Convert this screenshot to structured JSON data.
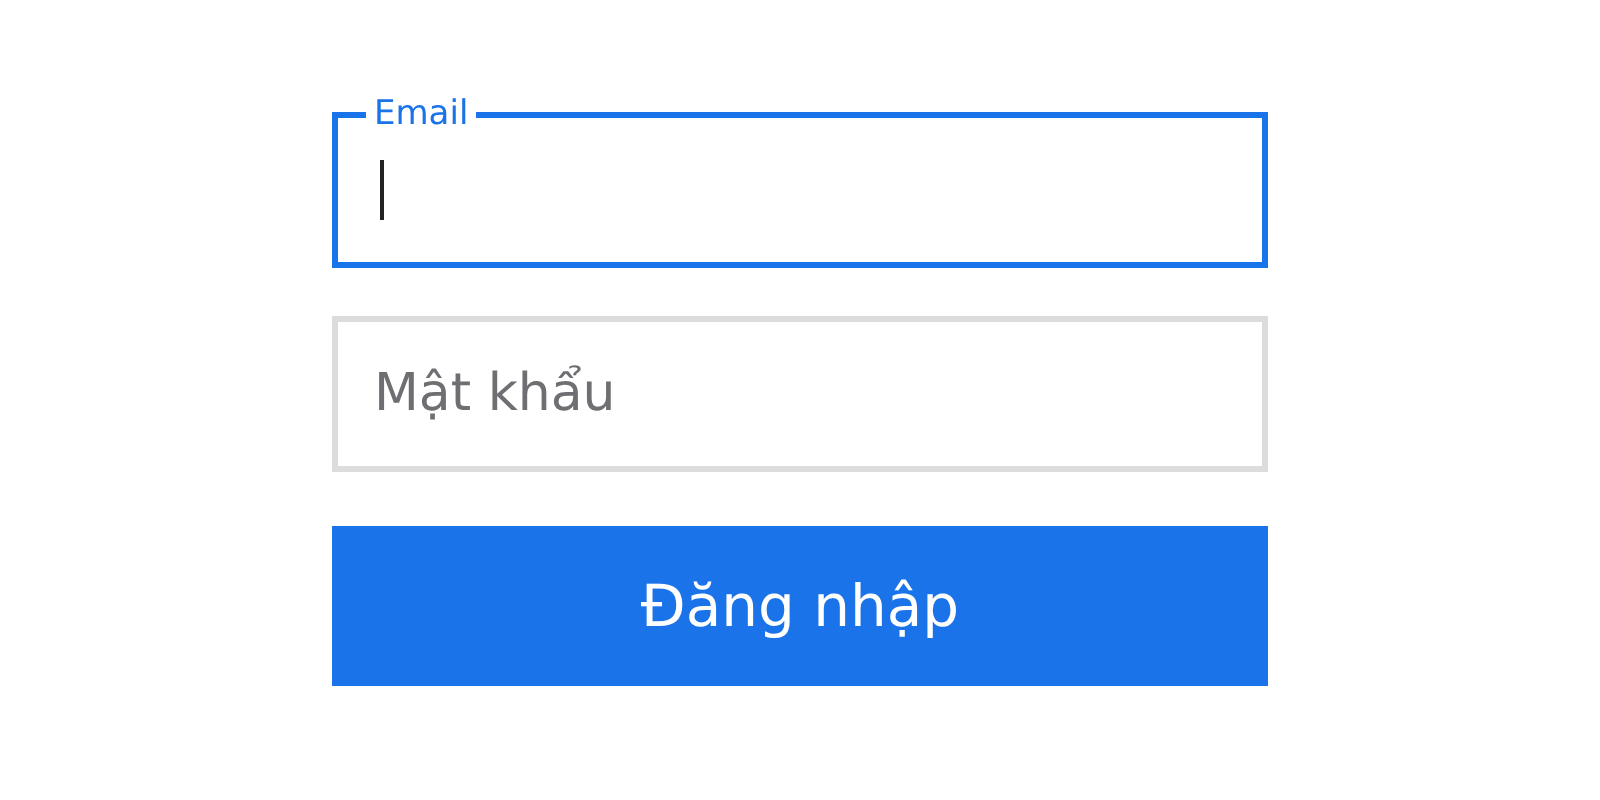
{
  "fields": [
    {
      "label": "Email",
      "focused": true
    },
    {
      "placeholder": "Mật khẩu",
      "focused": false
    }
  ],
  "button": {
    "label": "Đăng nhập"
  }
}
